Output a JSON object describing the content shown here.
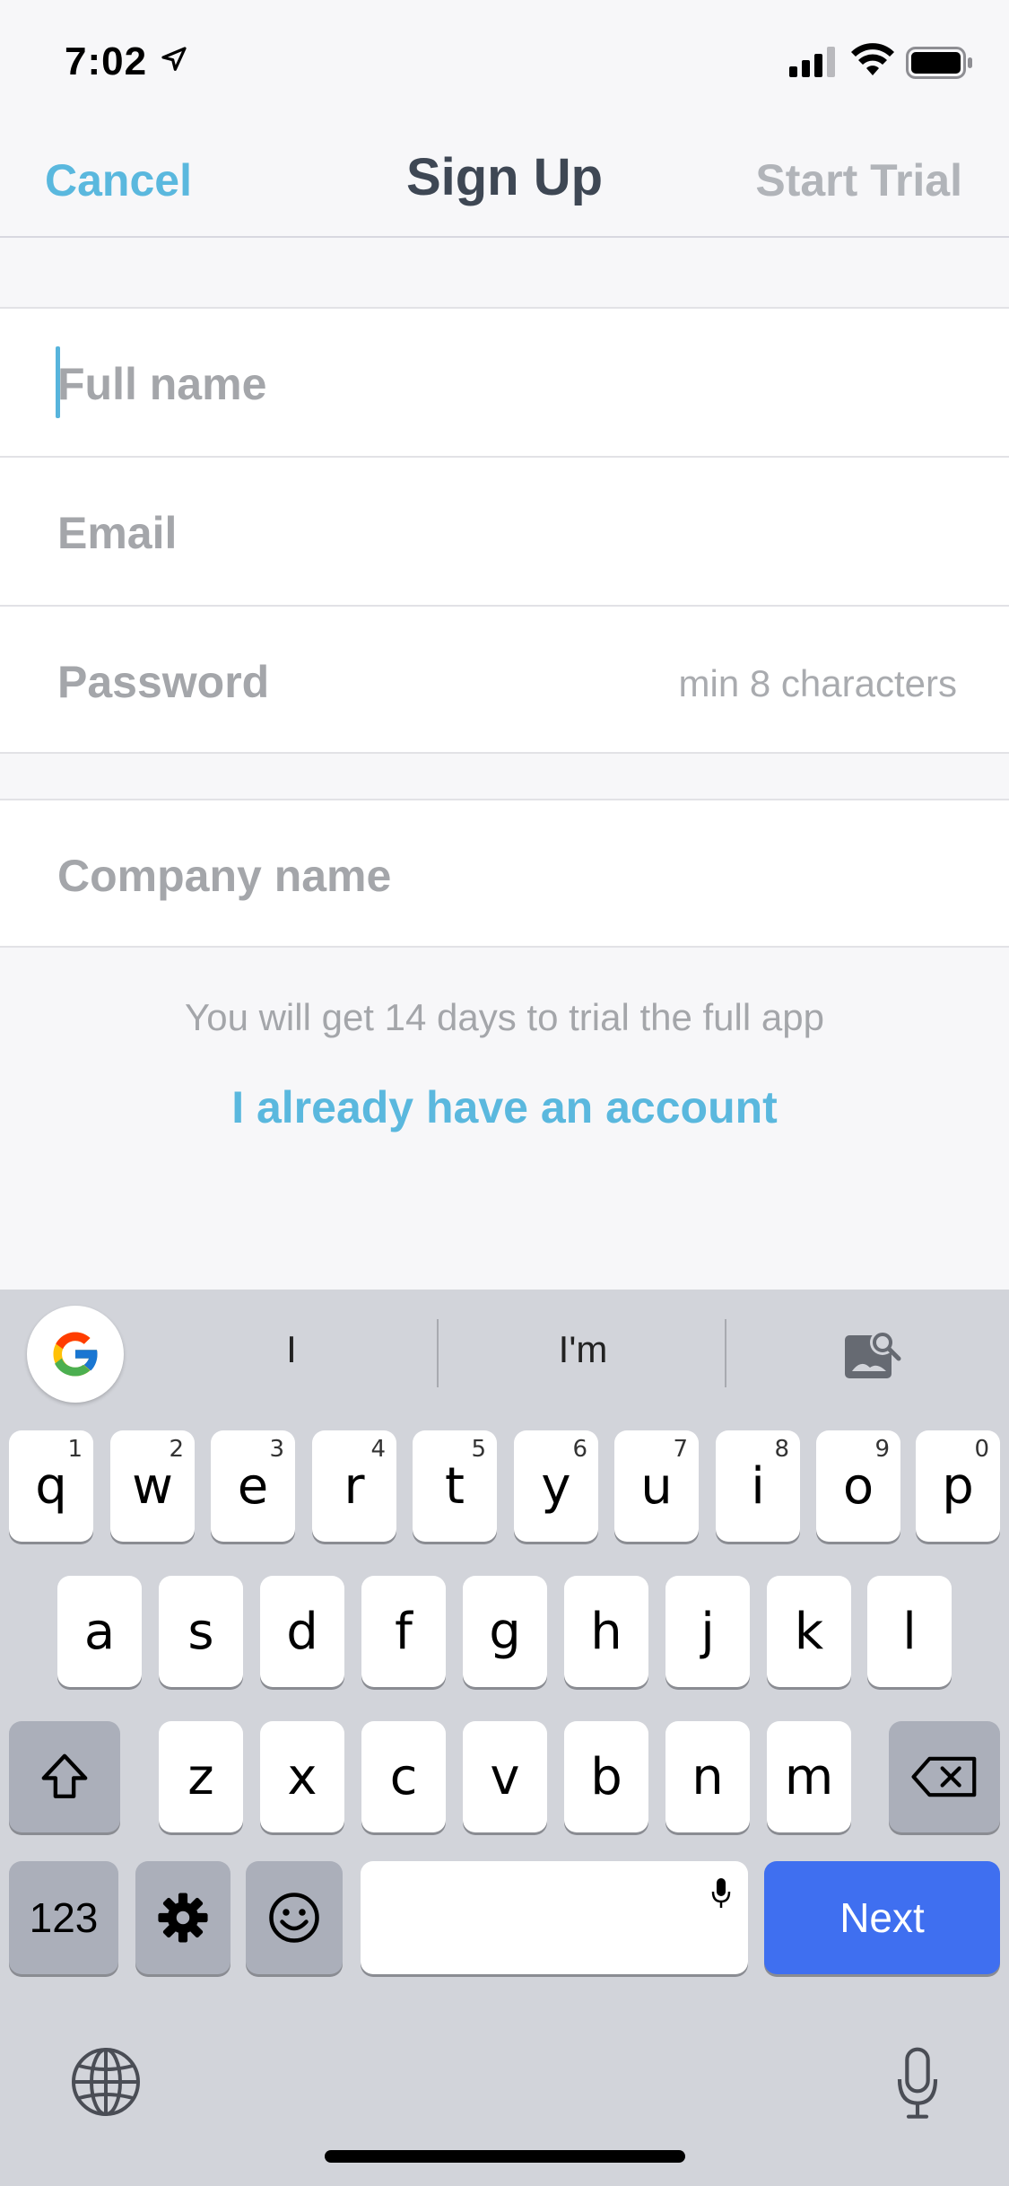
{
  "status_bar": {
    "time": "7:02"
  },
  "nav": {
    "cancel": "Cancel",
    "title": "Sign Up",
    "start_trial": "Start Trial"
  },
  "form": {
    "full_name": {
      "placeholder": "Full name"
    },
    "email": {
      "placeholder": "Email"
    },
    "password": {
      "placeholder": "Password",
      "hint": "min 8 characters"
    },
    "company": {
      "placeholder": "Company name"
    }
  },
  "trial_note": "You will get 14 days to trial the full app",
  "login_link": "I already have an account",
  "keyboard": {
    "suggestions": [
      "I",
      "I'm"
    ],
    "row1": [
      {
        "letter": "q",
        "num": "1"
      },
      {
        "letter": "w",
        "num": "2"
      },
      {
        "letter": "e",
        "num": "3"
      },
      {
        "letter": "r",
        "num": "4"
      },
      {
        "letter": "t",
        "num": "5"
      },
      {
        "letter": "y",
        "num": "6"
      },
      {
        "letter": "u",
        "num": "7"
      },
      {
        "letter": "i",
        "num": "8"
      },
      {
        "letter": "o",
        "num": "9"
      },
      {
        "letter": "p",
        "num": "0"
      }
    ],
    "row2": [
      "a",
      "s",
      "d",
      "f",
      "g",
      "h",
      "j",
      "k",
      "l"
    ],
    "row3": [
      "z",
      "x",
      "c",
      "v",
      "b",
      "n",
      "m"
    ],
    "numbers_label": "123",
    "return_label": "Next"
  },
  "colors": {
    "accent": "#5ab8de",
    "next_key": "#3f6ff0",
    "keyboard_bg": "#d2d4da"
  },
  "icons": [
    "location-arrow-icon",
    "cellular-signal-icon",
    "wifi-icon",
    "battery-icon",
    "google-icon",
    "image-search-icon",
    "shift-icon",
    "delete-icon",
    "gear-icon",
    "emoji-icon",
    "mic-icon",
    "globe-icon"
  ]
}
